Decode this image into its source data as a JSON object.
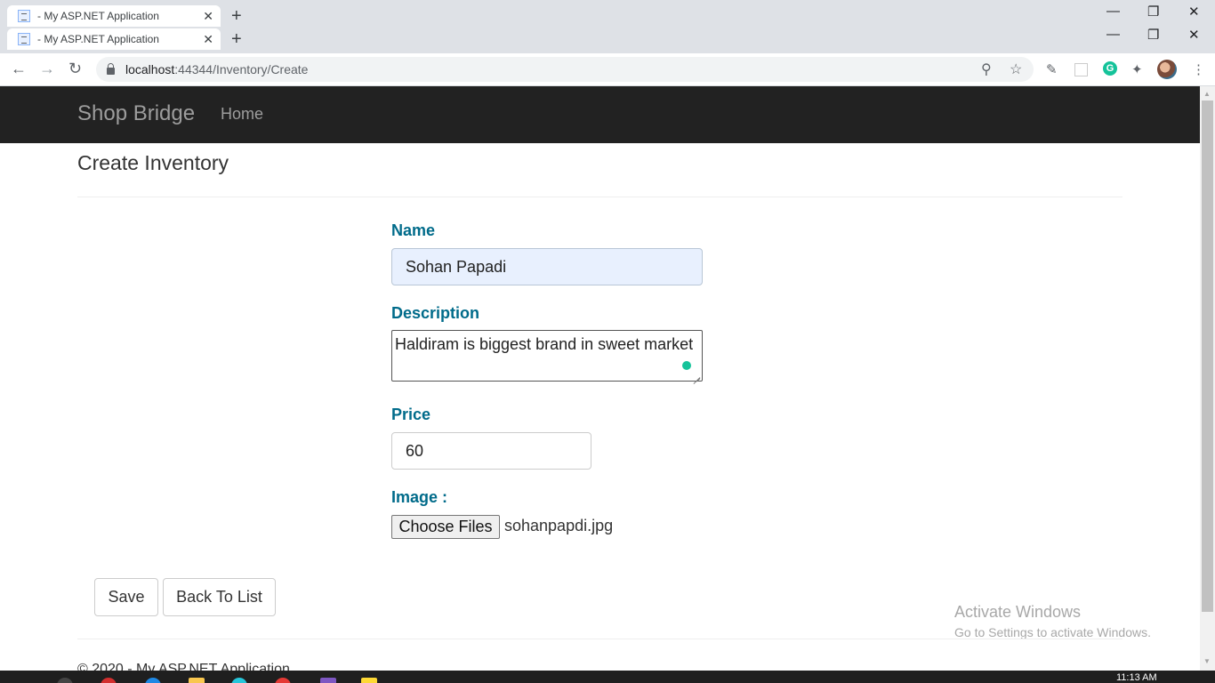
{
  "browser": {
    "tabs": [
      {
        "title": "- My ASP.NET Application",
        "close": "✕"
      },
      {
        "title": "- My ASP.NET Application",
        "close": "✕"
      }
    ],
    "new_tab": "+",
    "window_controls": {
      "minimize": "—",
      "restore": "❐",
      "close": "✕"
    },
    "nav": {
      "back": "←",
      "forward": "→",
      "reload": "↻"
    },
    "url": {
      "host": "localhost",
      "path": ":44344/Inventory/Create"
    },
    "icons": {
      "zoom": "zoom-icon",
      "bookmark": "star-icon",
      "eyedropper": "eyedropper-icon",
      "extension": "extension-icon",
      "grammarly": "G",
      "puzzle": "puzzle-icon",
      "menu": "⋮"
    }
  },
  "navbar": {
    "brand": "Shop Bridge",
    "home": "Home"
  },
  "page": {
    "title": "Create Inventory",
    "name_label": "Name",
    "name_value": "Sohan Papadi",
    "description_label": "Description",
    "description_value": "Haldiram is biggest brand in sweet market",
    "price_label": "Price",
    "price_value": "60",
    "image_label": "Image :",
    "choose_files": "Choose Files",
    "file_name": "sohanpapdi.jpg",
    "save": "Save",
    "back_to_list": "Back To List"
  },
  "watermark": {
    "title": "Activate Windows",
    "subtitle": "Go to Settings to activate Windows."
  },
  "footer": {
    "text": "© 2020 - My ASP.NET Application"
  },
  "taskbar": {
    "time": "11:13 AM"
  }
}
